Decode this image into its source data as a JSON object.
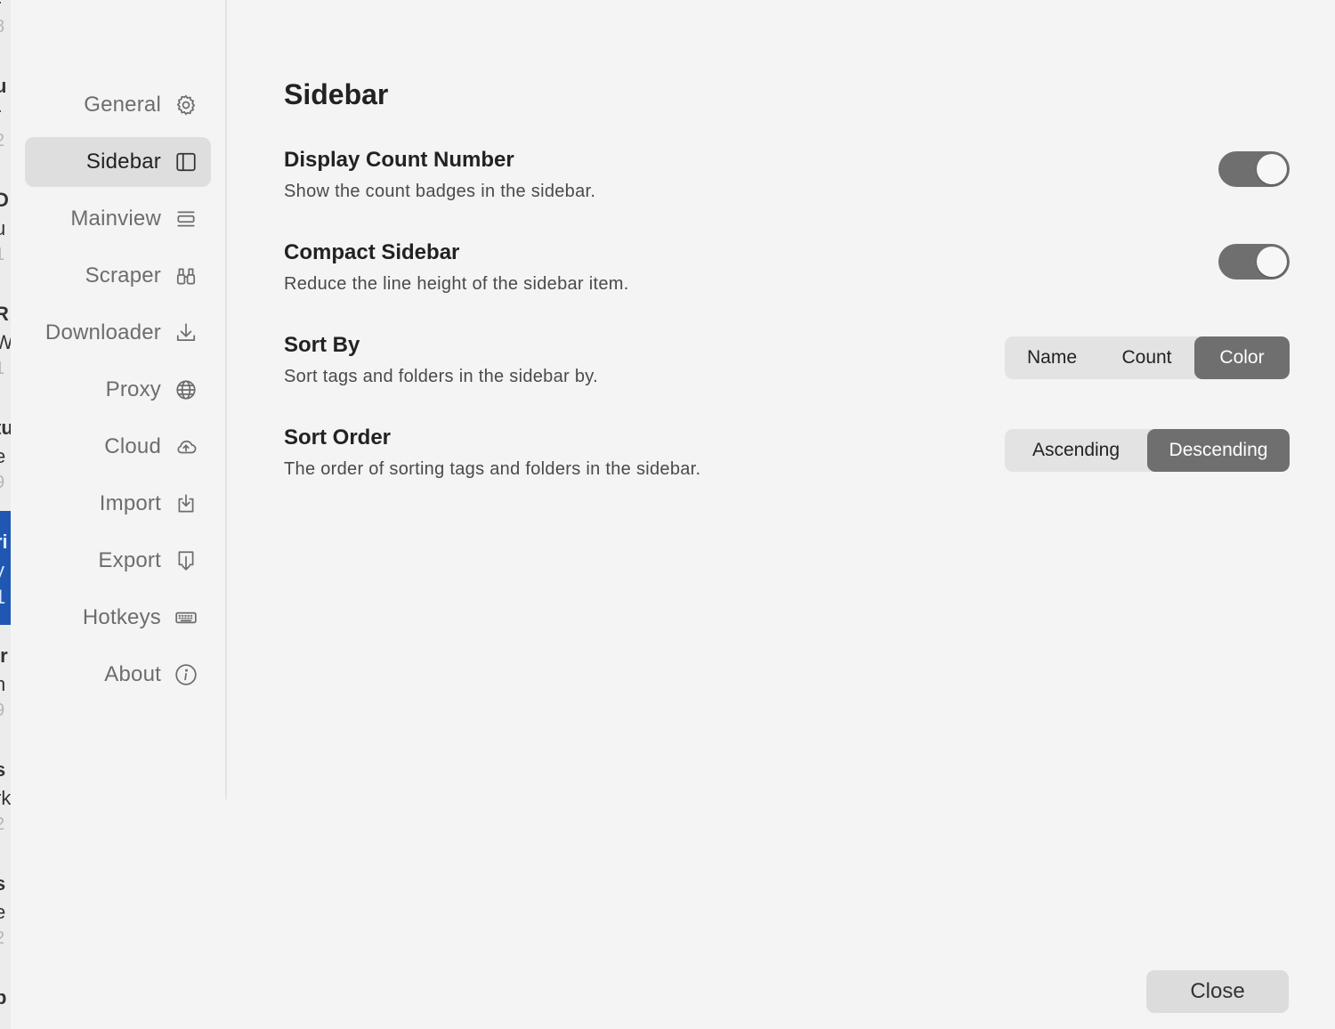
{
  "background_window": {
    "fragments": [
      "r",
      "8",
      "u",
      "r",
      "2",
      "D",
      "u",
      "1",
      "R:",
      "W",
      "1",
      "tu",
      "e",
      "9",
      "ri",
      "y",
      "1",
      "ir",
      "n",
      "9",
      "s",
      "rk",
      "2",
      "s",
      "e",
      "2",
      "p"
    ],
    "selection_color": "#1f57b3"
  },
  "nav": {
    "items": [
      {
        "label": "General",
        "icon": "gear-icon"
      },
      {
        "label": "Sidebar",
        "icon": "sidebar-icon",
        "active": true
      },
      {
        "label": "Mainview",
        "icon": "list-icon"
      },
      {
        "label": "Scraper",
        "icon": "binoculars-icon"
      },
      {
        "label": "Downloader",
        "icon": "download-icon"
      },
      {
        "label": "Proxy",
        "icon": "globe-icon"
      },
      {
        "label": "Cloud",
        "icon": "cloud-upload-icon"
      },
      {
        "label": "Import",
        "icon": "import-icon"
      },
      {
        "label": "Export",
        "icon": "export-icon"
      },
      {
        "label": "Hotkeys",
        "icon": "keyboard-icon"
      },
      {
        "label": "About",
        "icon": "info-icon"
      }
    ]
  },
  "main": {
    "title": "Sidebar",
    "settings": {
      "display_count": {
        "title": "Display Count Number",
        "description": "Show the count badges in the sidebar.",
        "enabled": true
      },
      "compact_sidebar": {
        "title": "Compact Sidebar",
        "description": "Reduce the line height of the sidebar item.",
        "enabled": true
      },
      "sort_by": {
        "title": "Sort By",
        "description": "Sort tags and folders in the sidebar by.",
        "options": [
          "Name",
          "Count",
          "Color"
        ],
        "selected": "Color"
      },
      "sort_order": {
        "title": "Sort Order",
        "description": "The order of sorting tags and folders in the sidebar.",
        "options": [
          "Ascending",
          "Descending"
        ],
        "selected": "Descending"
      }
    }
  },
  "footer": {
    "close_label": "Close"
  },
  "colors": {
    "background": "#f4f4f4",
    "active_nav": "#dedede",
    "toggle_on": "#6f6f6f",
    "segment_selected": "#6f6f6f"
  }
}
